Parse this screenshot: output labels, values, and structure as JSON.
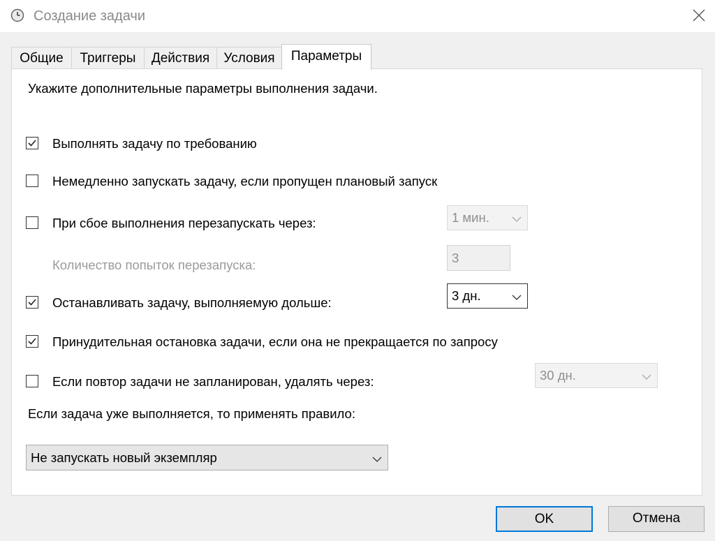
{
  "window": {
    "title": "Создание задачи",
    "icon": "clock-icon"
  },
  "tabs": [
    {
      "label": "Общие",
      "active": false
    },
    {
      "label": "Триггеры",
      "active": false
    },
    {
      "label": "Действия",
      "active": false
    },
    {
      "label": "Условия",
      "active": false
    },
    {
      "label": "Параметры",
      "active": true
    }
  ],
  "settings": {
    "intro": "Укажите дополнительные параметры выполнения задачи.",
    "run_on_demand": {
      "label": "Выполнять задачу по требованию",
      "checked": true
    },
    "run_missed": {
      "label": "Немедленно запускать задачу, если пропущен плановый запуск",
      "checked": false
    },
    "restart_on_fail": {
      "label": "При сбое выполнения перезапускать через:",
      "checked": false,
      "interval": "1 мин."
    },
    "restart_count": {
      "label": "Количество попыток перезапуска:",
      "value": "3"
    },
    "stop_if_longer": {
      "label": "Останавливать задачу, выполняемую дольше:",
      "checked": true,
      "duration": "3 дн."
    },
    "force_stop": {
      "label": "Принудительная остановка задачи, если она не прекращается по запросу",
      "checked": true
    },
    "delete_if_not_scheduled": {
      "label": "Если повтор задачи не запланирован, удалять через:",
      "checked": false,
      "duration": "30 дн."
    },
    "running_rule_label": "Если задача уже выполняется, то применять правило:",
    "running_rule_value": "Не запускать новый экземпляр"
  },
  "buttons": {
    "ok": "OK",
    "cancel": "Отмена"
  }
}
